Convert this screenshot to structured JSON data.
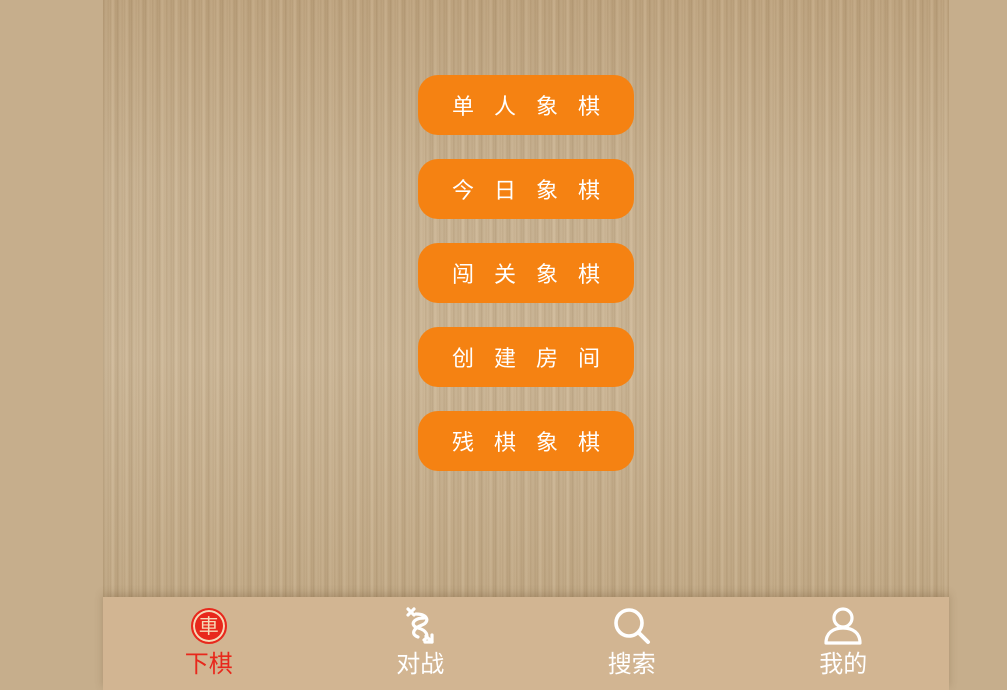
{
  "menu": {
    "items": [
      {
        "label": "单人象棋"
      },
      {
        "label": "今日象棋"
      },
      {
        "label": "闯关象棋"
      },
      {
        "label": "创建房间"
      },
      {
        "label": "残棋象棋"
      }
    ]
  },
  "tabbar": {
    "tabs": [
      {
        "label": "下棋",
        "icon": "chess-piece-icon",
        "icon_text": "車",
        "active": true
      },
      {
        "label": "对战",
        "icon": "battle-swap-icon",
        "active": false
      },
      {
        "label": "搜索",
        "icon": "search-icon",
        "active": false
      },
      {
        "label": "我的",
        "icon": "user-icon",
        "active": false
      }
    ]
  },
  "colors": {
    "button_orange": "#f58212",
    "active_red": "#e8281c",
    "tabbar_bg": "#d2b592",
    "wood_bg": "#c9b291"
  }
}
